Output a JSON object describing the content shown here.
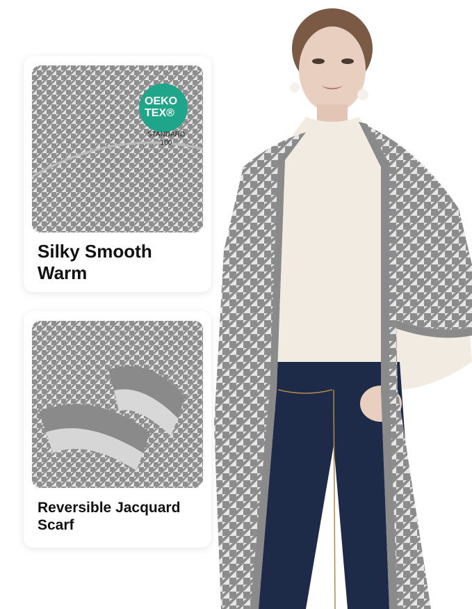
{
  "features": [
    {
      "line1": "Silky Smooth",
      "line2": "Warm"
    },
    {
      "line1": "Reversible Jacquard",
      "line2": "Scarf"
    }
  ],
  "badge": {
    "line1": "OEKO",
    "line2": "TEX®",
    "standard_line1": "STANDARD",
    "standard_line2": "100",
    "color": "#1fa58a"
  },
  "colors": {
    "pattern_dark": "#8c8c8c",
    "pattern_light": "#e6e6e6",
    "sweater": "#f1ebe2",
    "jeans": "#1e2b48",
    "skin": "#e9cfc0",
    "hair": "#7a5a44"
  }
}
